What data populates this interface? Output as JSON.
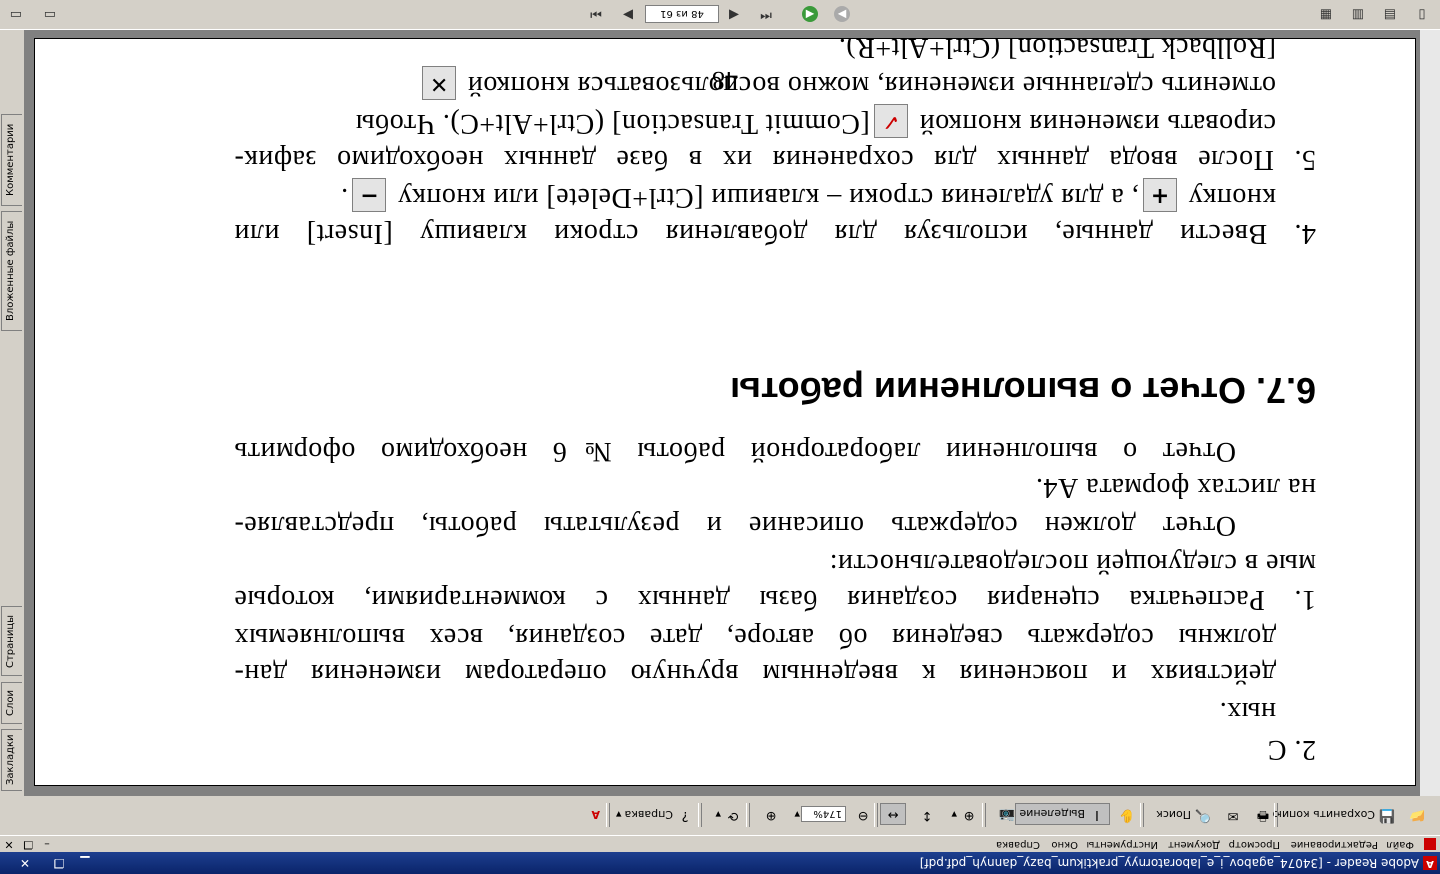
{
  "window": {
    "title": "Adobe Reader - [34074_agabov_i_e_laboratornyy_praktikum_bazy_dannyh_pdf.pdf]",
    "app_icon": "adobe-reader-icon"
  },
  "menu": {
    "items": [
      "Файл",
      "Редактирование",
      "Просмотр",
      "Документ",
      "Инструменты",
      "Окно",
      "Справка"
    ]
  },
  "toolbar": {
    "save_copy": "Сохранить копию",
    "search": "Поиск",
    "select": "Выделение",
    "zoom_value": "174%",
    "help": "Справка"
  },
  "side_tabs": [
    "Закладки",
    "Слои",
    "Страницы",
    "Вложенные файлы",
    "Комментарии"
  ],
  "navigation": {
    "page_indicator": "48 из 61"
  },
  "document": {
    "lines": [
      "4.  Ввести данные, используя для добавления строки клавишу [Insert] или",
      "кнопку",
      ", а для удаления строки – клавиши [Ctrl+Delete] или кнопку",
      ".",
      "5.  После ввода данных для сохранения их в базе данных необходимо зафик-",
      "сировать изменения кнопкой",
      "[Commit Transaction] (Ctrl+Alt+C). Чтобы",
      "отменить сделанные изменения, можно воспользоваться кнопкой",
      "[Rollback Transaction] (Ctrl+Alt+R).",
      "Отчет о выполнении лабораторной работы №6 необходимо оформить",
      "на листах формата А4.",
      "Отчет должен содержать описание и результаты работы, представляе-",
      "мые в следующей последовательности:",
      "1.  Распечатка сценария создания базы данных с комментариями, которые",
      "должны содержать сведения об авторе, дате создания, всех выполняемых",
      "действиях и пояснения к введенным вручную операторам изменения дан-",
      "ных.",
      "2.  С"
    ],
    "heading": "6.7.   Отчет о выполнении работы",
    "page_number": "48"
  }
}
